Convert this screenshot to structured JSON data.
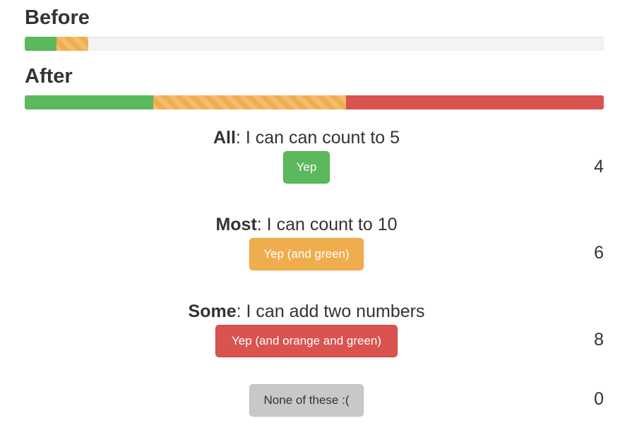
{
  "before": {
    "title": "Before",
    "segments": [
      {
        "type": "green",
        "percent": 5.5
      },
      {
        "type": "orange",
        "percent": 5.5
      }
    ]
  },
  "after": {
    "title": "After",
    "segments": [
      {
        "type": "green",
        "percent": 22.2
      },
      {
        "type": "orange",
        "percent": 33.3
      },
      {
        "type": "red",
        "percent": 44.5
      }
    ]
  },
  "questions": [
    {
      "level": "All",
      "text": ": I can can count to 5",
      "button": "Yep",
      "count": "4",
      "color": "green"
    },
    {
      "level": "Most",
      "text": ": I can count to 10",
      "button": "Yep (and green)",
      "count": "6",
      "color": "orange"
    },
    {
      "level": "Some",
      "text": ": I can add two numbers",
      "button": "Yep (and orange and green)",
      "count": "8",
      "color": "red"
    }
  ],
  "none": {
    "button": "None of these :(",
    "count": "0"
  },
  "colors": {
    "green": "#5cb85c",
    "orange": "#f0ad4e",
    "red": "#d9534f",
    "grey": "#c8c8c8"
  }
}
